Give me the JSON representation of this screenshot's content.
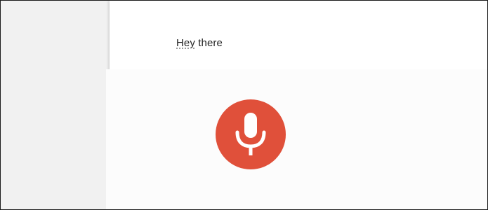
{
  "document": {
    "word_1": "Hey",
    "word_2": " there"
  },
  "voice_typing": {
    "mic_icon": "microphone-icon",
    "mic_color": "#e0503a",
    "state": "listening"
  }
}
